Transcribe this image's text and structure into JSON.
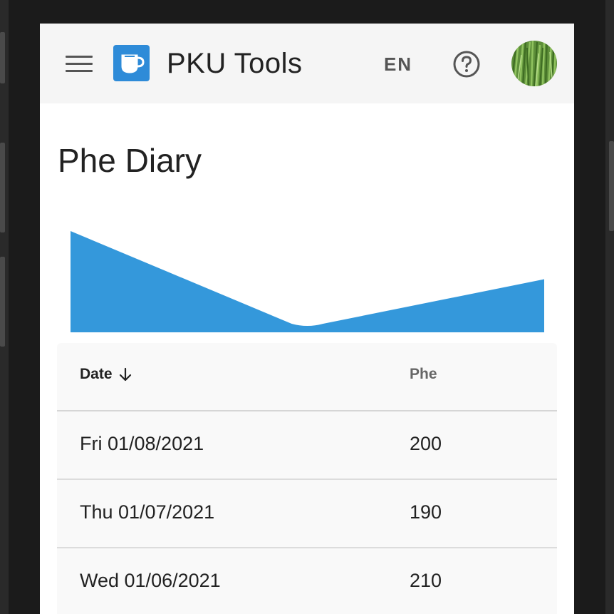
{
  "app": {
    "title": "PKU Tools",
    "language": "EN",
    "brand_color": "#3498db"
  },
  "page": {
    "title": "Phe Diary"
  },
  "chart_data": {
    "type": "area",
    "x": [
      "Wed 01/06/2021",
      "Thu 01/07/2021",
      "Fri 01/08/2021"
    ],
    "series": [
      {
        "values": [
          210,
          190,
          200
        ]
      }
    ],
    "color": "#3498db",
    "title": "",
    "xlabel": "",
    "ylabel": ""
  },
  "table": {
    "columns": {
      "date": "Date",
      "phe": "Phe"
    },
    "sort": {
      "column": "date",
      "direction": "descending"
    },
    "rows": [
      {
        "date": "Fri 01/08/2021",
        "phe": "200"
      },
      {
        "date": "Thu 01/07/2021",
        "phe": "190"
      },
      {
        "date": "Wed 01/06/2021",
        "phe": "210"
      }
    ]
  },
  "icons": {
    "menu": "menu-icon",
    "logo": "coffee-cup-icon",
    "help": "help-circle-icon",
    "sort": "arrow-down-icon",
    "avatar": "avatar-grass"
  }
}
